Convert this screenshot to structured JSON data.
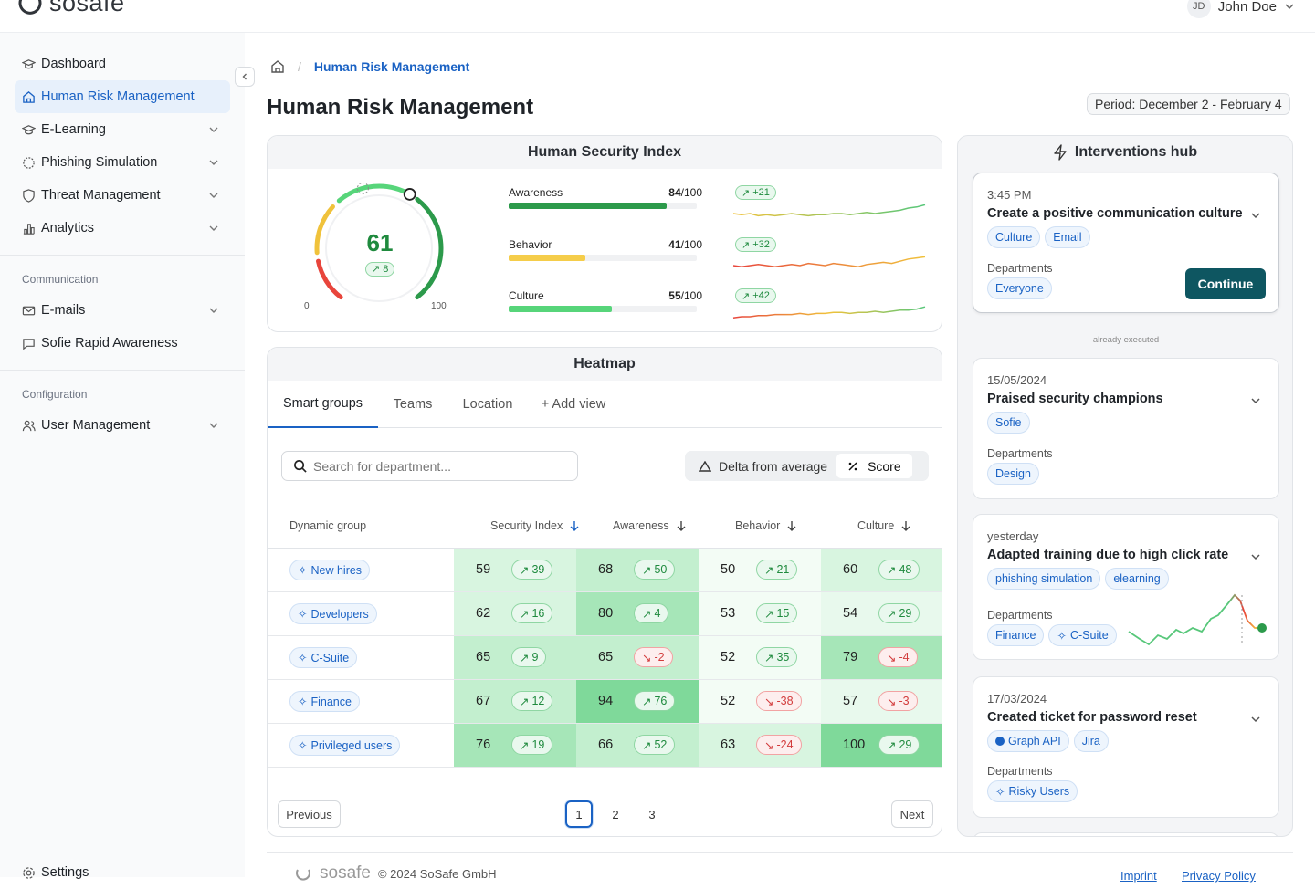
{
  "app": {
    "logo_text": "sosafe",
    "user_initials": "JD",
    "user_name": "John Doe"
  },
  "sidebar": {
    "items": [
      {
        "label": "Dashboard",
        "icon": "graduation-cap-icon"
      },
      {
        "label": "Human Risk Management",
        "icon": "home-icon"
      },
      {
        "label": "E-Learning",
        "icon": "graduation-cap-icon"
      },
      {
        "label": "Phishing Simulation",
        "icon": "hook-icon"
      },
      {
        "label": "Threat Management",
        "icon": "shield-icon"
      },
      {
        "label": "Analytics",
        "icon": "bar-chart-icon"
      }
    ],
    "communication_label": "Communication",
    "communication_items": [
      {
        "label": "E-mails",
        "icon": "mail-icon"
      },
      {
        "label": "Sofie Rapid Awareness",
        "icon": "chat-icon"
      }
    ],
    "configuration_label": "Configuration",
    "configuration_items": [
      {
        "label": "User Management",
        "icon": "users-icon"
      }
    ],
    "settings_label": "Settings"
  },
  "breadcrumb": {
    "current": "Human Risk Management"
  },
  "page": {
    "title": "Human Risk Management",
    "period": "Period: December 2 - February 4"
  },
  "hsi": {
    "title": "Human Security Index",
    "score": "61",
    "delta": "8",
    "gauge_value": 61,
    "gauge_min": "0",
    "gauge_max": "100",
    "metrics": [
      {
        "label": "Awareness",
        "value": "84",
        "max": "/100",
        "delta": "+21",
        "fill": 0.84,
        "color": "#2c9a4b"
      },
      {
        "label": "Behavior",
        "value": "41",
        "max": "/100",
        "delta": "+32",
        "fill": 0.41,
        "color": "#f5cd4a"
      },
      {
        "label": "Culture",
        "value": "55",
        "max": "/100",
        "delta": "+42",
        "fill": 0.55,
        "color": "#57d57a"
      }
    ]
  },
  "heatmap": {
    "title": "Heatmap",
    "tabs": [
      "Smart groups",
      "Teams",
      "Location",
      "+ Add view"
    ],
    "search_placeholder": "Search for department...",
    "toggle": {
      "delta": "Delta from average",
      "score": "Score"
    },
    "columns": [
      "Dynamic group",
      "Security Index",
      "Awareness",
      "Behavior",
      "Culture"
    ],
    "rows": [
      {
        "group": "New hires",
        "cells": [
          [
            "59",
            "39"
          ],
          [
            "68",
            "50"
          ],
          [
            "50",
            "21"
          ],
          [
            "60",
            "48"
          ]
        ]
      },
      {
        "group": "Developers",
        "cells": [
          [
            "62",
            "16"
          ],
          [
            "80",
            "4"
          ],
          [
            "53",
            "15"
          ],
          [
            "54",
            "29"
          ]
        ]
      },
      {
        "group": "C-Suite",
        "cells": [
          [
            "65",
            "9"
          ],
          [
            "65",
            "-2"
          ],
          [
            "52",
            "35"
          ],
          [
            "79",
            "-4"
          ]
        ]
      },
      {
        "group": "Finance",
        "cells": [
          [
            "67",
            "12"
          ],
          [
            "94",
            "76"
          ],
          [
            "52",
            "-38"
          ],
          [
            "57",
            "-3"
          ]
        ]
      },
      {
        "group": "Privileged users",
        "cells": [
          [
            "76",
            "19"
          ],
          [
            "66",
            "52"
          ],
          [
            "63",
            "-24"
          ],
          [
            "100",
            "29"
          ]
        ]
      }
    ],
    "pagination": {
      "previous": "Previous",
      "next": "Next",
      "pages": [
        "1",
        "2",
        "3"
      ],
      "current": "1"
    }
  },
  "interventions": {
    "title": "Interventions hub",
    "divider": "already executed",
    "departments_label": "Departments",
    "continue_label": "Continue",
    "items": [
      {
        "time": "3:45 PM",
        "title": "Create a positive communication culture",
        "tags": [
          "Culture",
          "Email"
        ],
        "departments": [
          "Everyone"
        ]
      },
      {
        "time": "15/05/2024",
        "title": "Praised security champions",
        "tags": [
          "Sofie"
        ],
        "departments": [
          "Design"
        ]
      },
      {
        "time": "yesterday",
        "title": "Adapted training due to high click rate",
        "tags": [
          "phishing simulation",
          "elearning"
        ],
        "departments": [
          "Finance",
          "C-Suite"
        ]
      },
      {
        "time": "17/03/2024",
        "title": "Created ticket for password reset",
        "tags": [
          "Graph API",
          "Jira"
        ],
        "departments": [
          "Risky Users"
        ]
      }
    ]
  },
  "footer": {
    "logo_text": "sosafe",
    "copyright": "© 2024 SoSafe GmbH",
    "imprint": "Imprint",
    "privacy": "Privacy Policy"
  }
}
